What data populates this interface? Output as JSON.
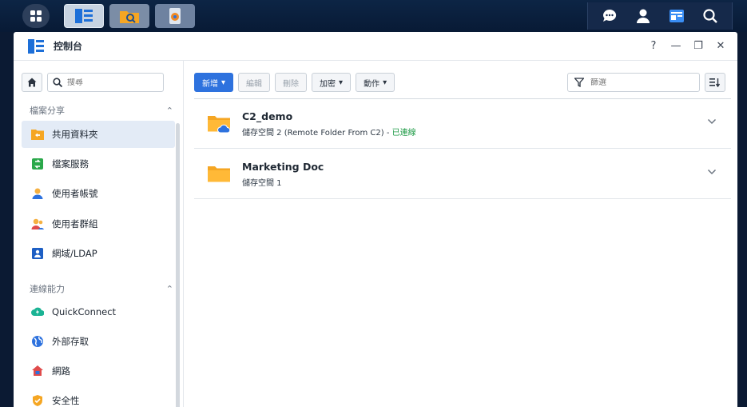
{
  "taskbar": {
    "main_menu_icon": "main-menu-grid-icon",
    "apps": [
      "control-panel-icon",
      "file-station-icon",
      "storage-manager-icon"
    ],
    "tray_icons": [
      "chat-icon",
      "user-icon",
      "widgets-icon",
      "search-icon"
    ]
  },
  "window": {
    "title": "控制台",
    "controls": {
      "help": "?",
      "minimize": "—",
      "restore": "❐",
      "close": "✕"
    }
  },
  "sidebar": {
    "search_placeholder": "搜尋",
    "sections": [
      {
        "title": "檔案分享",
        "items": [
          {
            "label": "共用資料夾",
            "icon": "shared-folder-icon",
            "active": true
          },
          {
            "label": "檔案服務",
            "icon": "file-services-icon"
          },
          {
            "label": "使用者帳號",
            "icon": "user-account-icon"
          },
          {
            "label": "使用者群組",
            "icon": "user-group-icon"
          },
          {
            "label": "網域/LDAP",
            "icon": "domain-ldap-icon"
          }
        ]
      },
      {
        "title": "連線能力",
        "items": [
          {
            "label": "QuickConnect",
            "icon": "quickconnect-icon"
          },
          {
            "label": "外部存取",
            "icon": "external-access-icon"
          },
          {
            "label": "網路",
            "icon": "network-icon"
          },
          {
            "label": "安全性",
            "icon": "security-shield-icon"
          }
        ]
      }
    ]
  },
  "toolbar": {
    "create": "新增",
    "edit": "編輯",
    "delete": "刪除",
    "encrypt": "加密",
    "action": "動作",
    "filter_placeholder": "篩選"
  },
  "folders": [
    {
      "name": "C2_demo",
      "location": "儲存空間 2 (Remote Folder From C2) - ",
      "status": "已連線",
      "remote": true
    },
    {
      "name": "Marketing Doc",
      "location": "儲存空間 1",
      "status": "",
      "remote": false
    }
  ],
  "colors": {
    "accent": "#2e72de",
    "connected": "#1f9b47",
    "folder": "#f5a623"
  }
}
